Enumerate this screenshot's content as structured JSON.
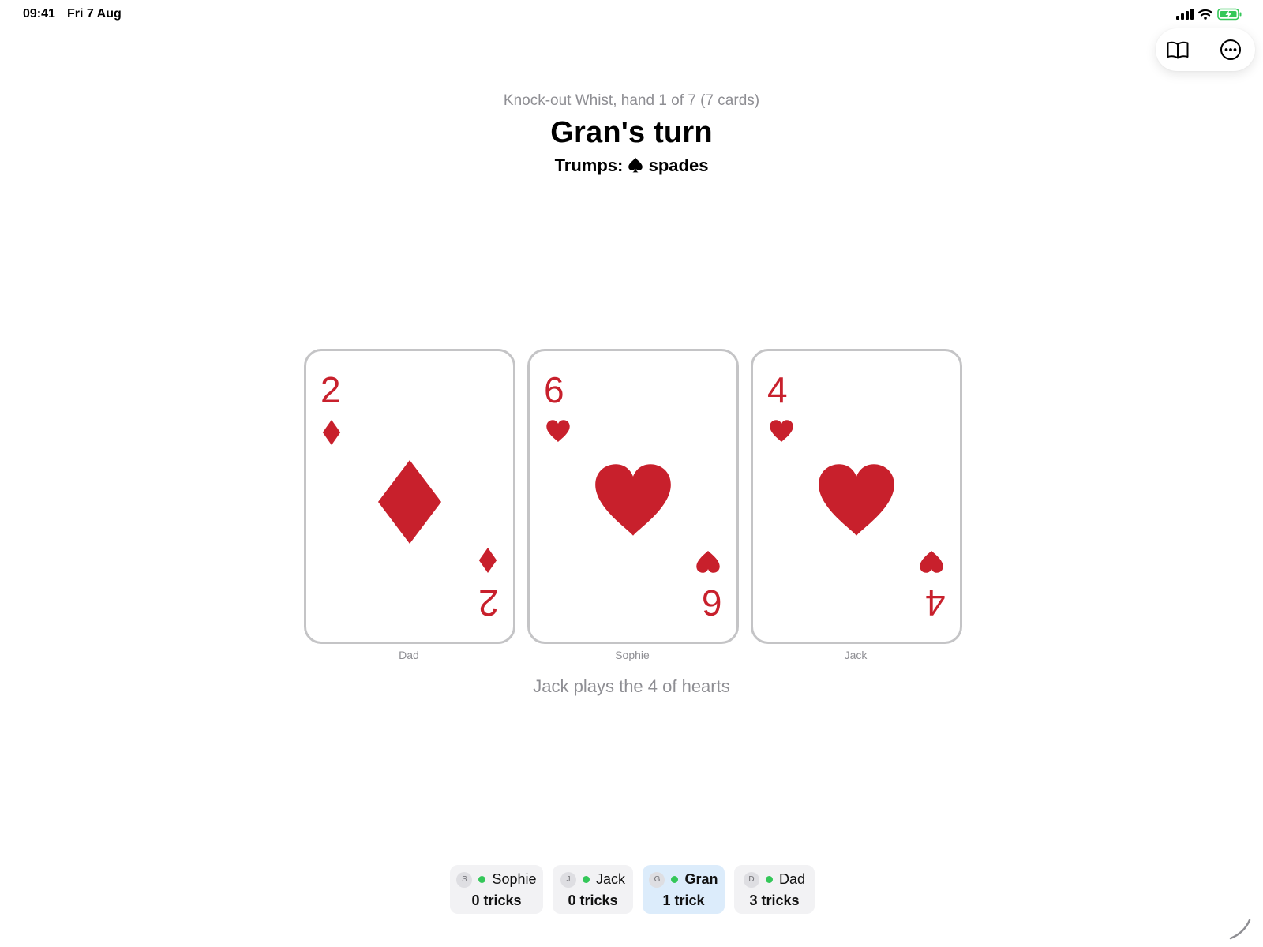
{
  "status_bar": {
    "time": "09:41",
    "date": "Fri 7 Aug"
  },
  "header": {
    "subtitle": "Knock-out Whist, hand 1 of 7 (7 cards)",
    "title": "Gran's turn",
    "trumps_prefix": "Trumps:",
    "trumps_suit": "spades"
  },
  "trick": {
    "cards": [
      {
        "rank": "2",
        "suit": "diamonds",
        "player": "Dad"
      },
      {
        "rank": "6",
        "suit": "hearts",
        "player": "Sophie"
      },
      {
        "rank": "4",
        "suit": "hearts",
        "player": "Jack"
      }
    ],
    "status": "Jack plays the 4 of hearts"
  },
  "players": [
    {
      "initial": "S",
      "name": "Sophie",
      "tricks": "0 tricks",
      "active": false
    },
    {
      "initial": "J",
      "name": "Jack",
      "tricks": "0 tricks",
      "active": false
    },
    {
      "initial": "G",
      "name": "Gran",
      "tricks": "1 trick",
      "active": true
    },
    {
      "initial": "D",
      "name": "Dad",
      "tricks": "3 tricks",
      "active": false
    }
  ],
  "colors": {
    "red_suit": "#c8202c",
    "card_border": "#c4c4c6",
    "active_pill": "#dcecfb",
    "pill": "#f2f2f4",
    "online_dot": "#34c759",
    "muted_text": "#8e8e93"
  },
  "icons": {
    "book": "book-icon",
    "more": "ellipsis-circle-icon",
    "spade": "spade-icon",
    "diamond": "diamond-icon",
    "heart": "heart-icon"
  }
}
